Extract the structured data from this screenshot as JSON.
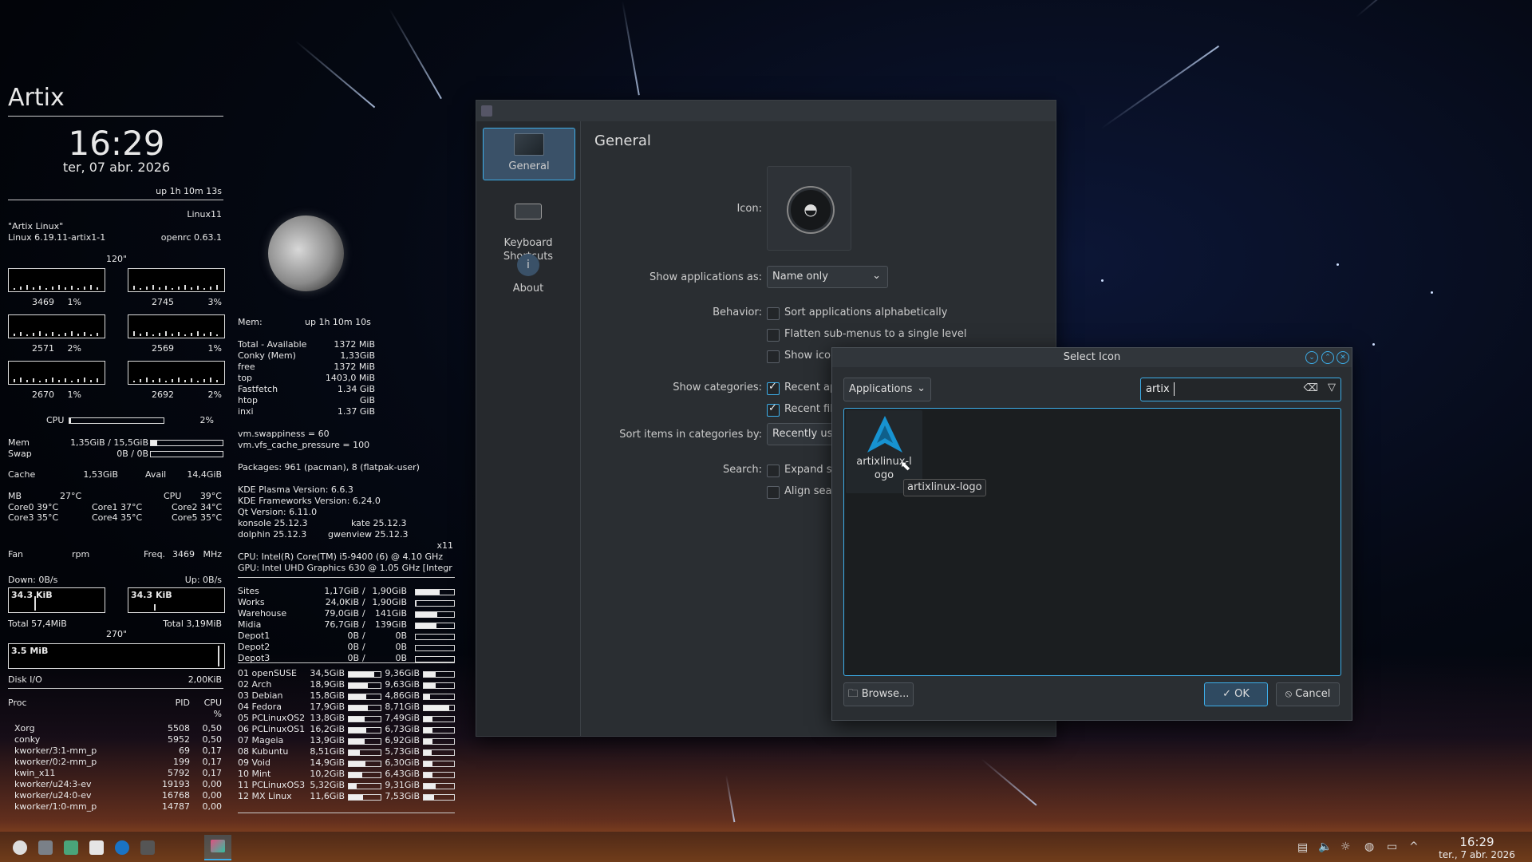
{
  "conky": {
    "hostname": "Artix",
    "time": "16:29",
    "date": "ter, 07 abr. 2026",
    "uptime": "up  1h 10m 13s",
    "host_tag": "Linux11",
    "distro": "\"Artix Linux\"",
    "kernel": "Linux 6.19.11-artix1-1",
    "init": "openrc 0.63.1",
    "graph_top_label": "120\"",
    "cores": [
      {
        "freq": "3469",
        "pct": "1%"
      },
      {
        "freq": "2745",
        "pct": "3%"
      },
      {
        "freq": "2571",
        "pct": "2%"
      },
      {
        "freq": "2569",
        "pct": "1%"
      },
      {
        "freq": "2670",
        "pct": "1%"
      },
      {
        "freq": "2692",
        "pct": "2%"
      }
    ],
    "cpu_label": "CPU",
    "cpu_pct": "2%",
    "cpu_fill": 0.02,
    "mem_label": "Mem",
    "mem_value": "1,35GiB / 15,5GiB",
    "mem_fill": 0.09,
    "swap_label": "Swap",
    "swap_value": "0B / 0B",
    "cache_label": "Cache",
    "cache_value": "1,53GiB",
    "avail_label": "Avail",
    "avail_value": "14,4GiB",
    "mb_label": "MB",
    "mb_temp": "27°C",
    "cpu_temp_label": "CPU",
    "cpu_temp": "39°C",
    "core_temps": [
      "Core0  39°C",
      "Core1 37°C",
      "Core2 34°C",
      "Core3  35°C",
      "Core4 35°C",
      "Core5 35°C"
    ],
    "fan_label": "Fan",
    "fan_value": "rpm",
    "freq_label": "Freq.",
    "freq_value": "3469",
    "freq_unit": "MHz",
    "down_label": "Down: 0B/s",
    "up_label": "Up: 0B/s",
    "down_graph": "34.3 KiB",
    "up_graph": "34.3 KiB",
    "total_down": "Total 57,4MiB",
    "total_up": "Total 3,19MiB",
    "disk_top_label": "270\"",
    "disk_graph": "3.5 MiB",
    "disk_io_label": "Disk I/O",
    "disk_io_value": "2,00KiB",
    "proc_header": {
      "name": "Proc",
      "pid": "PID",
      "cpu": "CPU",
      "pct": "%"
    },
    "procs": [
      {
        "name": "Xorg",
        "pid": "5508",
        "cpu": "0,50"
      },
      {
        "name": "conky",
        "pid": "5952",
        "cpu": "0,50"
      },
      {
        "name": "kworker/3:1-mm_p",
        "pid": "69",
        "cpu": "0,17"
      },
      {
        "name": "kworker/0:2-mm_p",
        "pid": "199",
        "cpu": "0,17"
      },
      {
        "name": "kwin_x11",
        "pid": "5792",
        "cpu": "0,17"
      },
      {
        "name": "kworker/u24:3-ev",
        "pid": "19193",
        "cpu": "0,00"
      },
      {
        "name": "kworker/u24:0-ev",
        "pid": "16768",
        "cpu": "0,00"
      },
      {
        "name": "kworker/1:0-mm_p",
        "pid": "14787",
        "cpu": "0,00"
      }
    ],
    "mem2": {
      "label": "Mem:",
      "uptime": "up  1h 10m 10s"
    },
    "mem_rows": [
      {
        "k": "Total - Available",
        "v": "1372 MiB"
      },
      {
        "k": "Conky (Mem)",
        "v": "1,33GiB"
      },
      {
        "k": "free",
        "v": "1372   MiB"
      },
      {
        "k": "top",
        "v": "1403,0  MiB"
      },
      {
        "k": "Fastfetch",
        "v": "1.34 GiB"
      },
      {
        "k": "htop",
        "v": "GiB"
      },
      {
        "k": "inxi",
        "v": "1.37 GiB"
      }
    ],
    "swappiness": "vm.swappiness = 60",
    "cache_pressure": "vm.vfs_cache_pressure = 100",
    "packages": "Packages: 961 (pacman), 8 (flatpak-user)",
    "plasma": "KDE Plasma Version: 6.6.3",
    "frameworks": "KDE Frameworks Version: 6.24.0",
    "qt": "Qt Version: 6.11.0",
    "konsole": "konsole 25.12.3",
    "kate": "kate 25.12.3",
    "dolphin": "dolphin 25.12.3",
    "gwenview": "gwenview 25.12.3",
    "session": "x11",
    "cpu_info": "CPU: Intel(R) Core(TM) i5-9400 (6) @ 4.10 GHz",
    "gpu_info": "GPU: Intel UHD Graphics 630 @ 1.05 GHz [Integr",
    "disks": [
      {
        "name": "Sites",
        "used": "1,17GiB",
        "total": "1,90GiB",
        "fill": 0.62
      },
      {
        "name": "Works",
        "used": "24,0KiB",
        "total": "1,90GiB",
        "fill": 0.02
      },
      {
        "name": "Warehouse",
        "used": "79,0GiB",
        "total": "141GiB",
        "fill": 0.56
      },
      {
        "name": "Midia",
        "used": "76,7GiB",
        "total": "139GiB",
        "fill": 0.55
      },
      {
        "name": "Depot1",
        "used": "0B",
        "total": "0B",
        "fill": 0
      },
      {
        "name": "Depot2",
        "used": "0B",
        "total": "0B",
        "fill": 0
      },
      {
        "name": "Depot3",
        "used": "0B",
        "total": "0B",
        "fill": 0
      }
    ],
    "distros": [
      {
        "name": "01 openSUSE",
        "a": "34,5GiB",
        "fa": 0.8,
        "b": "9,36GiB",
        "fb": 0.4
      },
      {
        "name": "02 Arch",
        "a": "18,9GiB",
        "fa": 0.6,
        "b": "9,63GiB",
        "fb": 0.4
      },
      {
        "name": "03 Debian",
        "a": "15,8GiB",
        "fa": 0.55,
        "b": "4,86GiB",
        "fb": 0.2
      },
      {
        "name": "04 Fedora",
        "a": "17,9GiB",
        "fa": 0.6,
        "b": "8,71GiB",
        "fb": 0.85
      },
      {
        "name": "05 PCLinuxOS2",
        "a": "13,8GiB",
        "fa": 0.5,
        "b": "7,49GiB",
        "fb": 0.3
      },
      {
        "name": "06 PCLinuxOS1",
        "a": "16,2GiB",
        "fa": 0.55,
        "b": "6,73GiB",
        "fb": 0.3
      },
      {
        "name": "07 Mageia",
        "a": "13,9GiB",
        "fa": 0.5,
        "b": "6,92GiB",
        "fb": 0.3
      },
      {
        "name": "08 Kubuntu",
        "a": "8,51GiB",
        "fa": 0.35,
        "b": "5,73GiB",
        "fb": 0.25
      },
      {
        "name": "09 Void",
        "a": "14,9GiB",
        "fa": 0.52,
        "b": "6,30GiB",
        "fb": 0.28
      },
      {
        "name": "10 Mint",
        "a": "10,2GiB",
        "fa": 0.42,
        "b": "6,43GiB",
        "fb": 0.28
      },
      {
        "name": "11 PCLinuxOS3",
        "a": "5,32GiB",
        "fa": 0.25,
        "b": "9,31GiB",
        "fb": 0.4
      },
      {
        "name": "12 MX Linux",
        "a": "11,6GiB",
        "fa": 0.45,
        "b": "7,53GiB",
        "fb": 0.33
      }
    ],
    "sep": "/"
  },
  "settings": {
    "sidebar": [
      {
        "label": "General"
      },
      {
        "label": "Keyboard\nShortcuts"
      },
      {
        "label": "About"
      }
    ],
    "page_title": "General",
    "icon_label": "Icon:",
    "show_apps_label": "Show applications as:",
    "show_apps_value": "Name only",
    "behavior_label": "Behavior:",
    "behavior_opts": [
      "Sort applications alphabetically",
      "Flatten sub-menus to a single level",
      "Show icons on the root level of the menu"
    ],
    "categories_label": "Show categories:",
    "categories_opts": [
      "Recent applications",
      "Recent files"
    ],
    "sort_label": "Sort items in categories by:",
    "sort_value": "Recently used",
    "search_label": "Search:",
    "search_opts": [
      "Expand search to bookmarks, files and emails",
      "Align search results to bottom"
    ]
  },
  "dialog": {
    "title": "Select Icon",
    "context_value": "Applications",
    "search_value": "artix",
    "icon_name": "artixlinux-logo",
    "tooltip": "artixlinux-logo",
    "browse": "Browse...",
    "ok": "OK",
    "cancel": "Cancel"
  },
  "taskbar": {
    "clock": "16:29",
    "date": "ter., 7 abr. 2026"
  },
  "colors": {
    "accent": "#3daee9",
    "artix": "#1793d1"
  }
}
